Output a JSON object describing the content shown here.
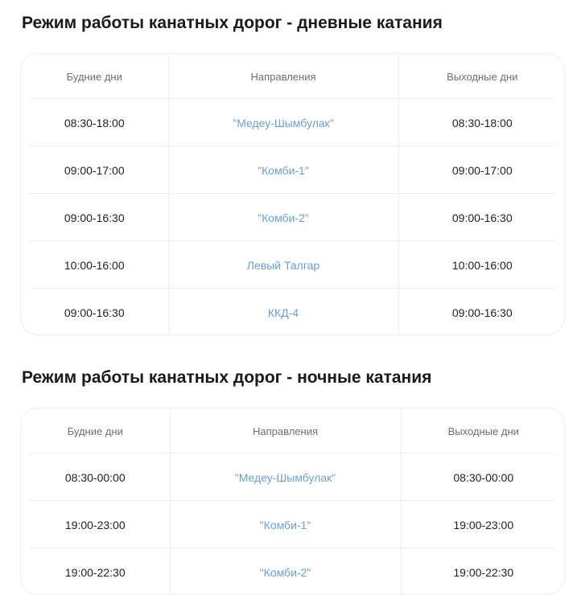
{
  "day": {
    "title": "Режим работы канатных дорог - дневные катания",
    "headers": [
      "Будние дни",
      "Направления",
      "Выходные дни"
    ],
    "rows": [
      {
        "weekday": "08:30-18:00",
        "direction": "\"Медеу-Шымбулак\"",
        "weekend": "08:30-18:00"
      },
      {
        "weekday": "09:00-17:00",
        "direction": "\"Комби-1\"",
        "weekend": "09:00-17:00"
      },
      {
        "weekday": "09:00-16:30",
        "direction": "\"Комби-2\"",
        "weekend": "09:00-16:30"
      },
      {
        "weekday": "10:00-16:00",
        "direction": "Левый Талгар",
        "weekend": "10:00-16:00"
      },
      {
        "weekday": "09:00-16:30",
        "direction": "ККД-4",
        "weekend": "09:00-16:30"
      }
    ]
  },
  "night": {
    "title": "Режим работы канатных дорог - ночные катания",
    "headers": [
      "Будние дни",
      "Направления",
      "Выходные дни"
    ],
    "rows": [
      {
        "weekday": "08:30-00:00",
        "direction": "\"Медеу-Шымбулак\"",
        "weekend": "08:30-00:00"
      },
      {
        "weekday": "19:00-23:00",
        "direction": "\"Комби-1\"",
        "weekend": "19:00-23:00"
      },
      {
        "weekday": "19:00-22:30",
        "direction": "\"Комби-2\"",
        "weekend": "19:00-22:30"
      }
    ]
  },
  "colors": {
    "direction_link": "#6a9fd4",
    "border": "#e8eef3",
    "header_text": "#6e6e6e",
    "body_text": "#1f1f1f"
  }
}
